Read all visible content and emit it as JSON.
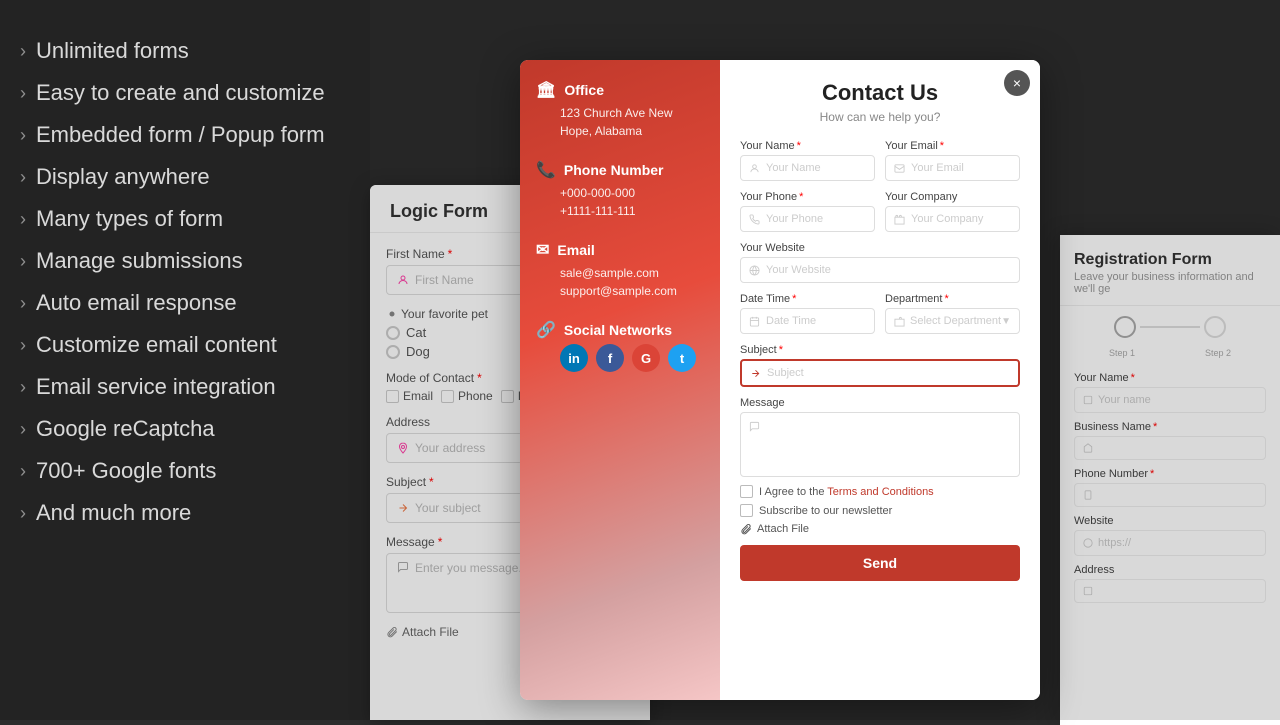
{
  "left_panel": {
    "features": [
      {
        "label": "Unlimited forms"
      },
      {
        "label": "Easy to create and customize"
      },
      {
        "label": "Embedded form / Popup form"
      },
      {
        "label": "Display anywhere"
      },
      {
        "label": "Many types of form"
      },
      {
        "label": "Manage submissions"
      },
      {
        "label": "Auto email response"
      },
      {
        "label": "Customize email content"
      },
      {
        "label": "Email service integration"
      },
      {
        "label": "Google reCaptcha"
      },
      {
        "label": "700+ Google fonts"
      },
      {
        "label": "And much more"
      }
    ]
  },
  "logic_form": {
    "title": "Logic Form",
    "fields": {
      "first_name_label": "First Name",
      "first_name_placeholder": "First Name",
      "pet_label": "Your favorite pet",
      "pet_options": [
        "Cat",
        "Dog"
      ],
      "mode_label": "Mode of Contact",
      "mode_options": [
        "Email",
        "Phone",
        "IM"
      ],
      "address_label": "Address",
      "address_placeholder": "Your address",
      "subject_label": "Subject",
      "subject_placeholder": "Your subject",
      "message_label": "Message",
      "message_placeholder": "Enter you message...",
      "attach_label": "Attach File"
    }
  },
  "contact_modal": {
    "close_label": "×",
    "title": "Contact Us",
    "subtitle": "How can we help you?",
    "left": {
      "office_title": "Office",
      "office_address": "123 Church Ave New\nHope, Alabama",
      "phone_title": "Phone Number",
      "phone_numbers": [
        "+000-000-000",
        "+1111-111-111"
      ],
      "email_title": "Email",
      "emails": [
        "sale@sample.com",
        "support@sample.com"
      ],
      "social_title": "Social Networks",
      "socials": [
        {
          "label": "in",
          "class": "social-linkedin"
        },
        {
          "label": "f",
          "class": "social-facebook"
        },
        {
          "label": "G",
          "class": "social-google"
        },
        {
          "label": "t",
          "class": "social-twitter"
        }
      ]
    },
    "form": {
      "your_name_label": "Your Name",
      "your_name_req": true,
      "your_name_placeholder": "Your Name",
      "your_email_label": "Your Email",
      "your_email_req": true,
      "your_email_placeholder": "Your Email",
      "your_phone_label": "Your Phone",
      "your_phone_req": true,
      "your_phone_placeholder": "Your Phone",
      "your_company_label": "Your Company",
      "your_company_placeholder": "Your Company",
      "your_website_label": "Your Website",
      "your_website_placeholder": "Your Website",
      "date_time_label": "Date Time",
      "date_time_req": true,
      "date_time_placeholder": "Date Time",
      "department_label": "Department",
      "department_req": true,
      "department_placeholder": "Select Department",
      "subject_label": "Subject",
      "subject_req": true,
      "subject_placeholder": "Subject",
      "message_label": "Message",
      "message_placeholder": "",
      "agree_label": "I Agree to the",
      "agree_link": "Terms and Conditions",
      "newsletter_label": "Subscribe to our newsletter",
      "attach_label": "Attach File",
      "send_label": "Send"
    }
  },
  "reg_form": {
    "title": "Registration Form",
    "subtitle": "Leave your business information and we'll ge",
    "step1_label": "Step 1",
    "step2_label": "Step 2",
    "fields": {
      "your_name_label": "Your Name",
      "your_name_req": true,
      "your_name_placeholder": "Your name",
      "business_name_label": "Business Name",
      "business_name_req": true,
      "phone_label": "Phone Number",
      "phone_req": true,
      "website_label": "Website",
      "website_placeholder": "https://",
      "address_label": "Address"
    }
  }
}
